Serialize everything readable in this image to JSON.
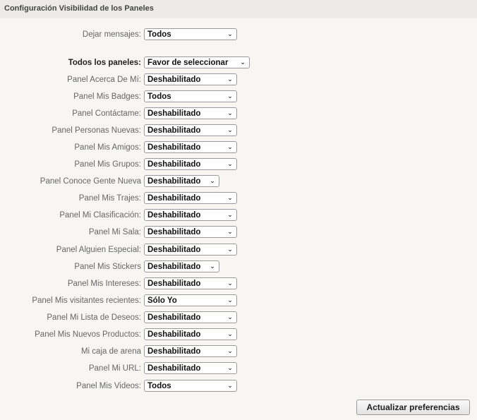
{
  "header": {
    "title": "Configuración Visibilidad de los Paneles"
  },
  "messages": {
    "label": "Dejar mensajes:",
    "value": "Todos"
  },
  "all_panels": {
    "label": "Todos los paneles:",
    "value": "Favor de seleccionar"
  },
  "panels": [
    {
      "label": "Panel Acerca De Mí:",
      "value": "Deshabilitado"
    },
    {
      "label": "Panel Mis Badges:",
      "value": "Todos"
    },
    {
      "label": "Panel Contáctame:",
      "value": "Deshabilitado"
    },
    {
      "label": "Panel Personas Nuevas:",
      "value": "Deshabilitado"
    },
    {
      "label": "Panel Mis Amigos:",
      "value": "Deshabilitado"
    },
    {
      "label": "Panel Mis Grupos:",
      "value": "Deshabilitado"
    },
    {
      "label": "Panel Conoce Gente Nueva",
      "value": "Deshabilitado"
    },
    {
      "label": "Panel Mis Trajes:",
      "value": "Deshabilitado"
    },
    {
      "label": "Panel Mi Clasificación:",
      "value": "Deshabilitado"
    },
    {
      "label": "Panel Mi Sala:",
      "value": "Deshabilitado"
    },
    {
      "label": "Panel Alguien Especial:",
      "value": "Deshabilitado"
    },
    {
      "label": "Panel Mis Stickers",
      "value": "Deshabilitado"
    },
    {
      "label": "Panel Mis Intereses:",
      "value": "Deshabilitado"
    },
    {
      "label": "Panel Mis visitantes recientes:",
      "value": "Sólo Yo"
    },
    {
      "label": "Panel Mi Lista de Deseos:",
      "value": "Deshabilitado"
    },
    {
      "label": "Panel Mis Nuevos Productos:",
      "value": "Deshabilitado"
    },
    {
      "label": "Mi caja de arena",
      "value": "Deshabilitado"
    },
    {
      "label": "Panel Mi URL:",
      "value": "Deshabilitado"
    },
    {
      "label": "Panel Mis Videos:",
      "value": "Todos"
    }
  ],
  "submit": {
    "label": "Actualizar preferencias"
  }
}
